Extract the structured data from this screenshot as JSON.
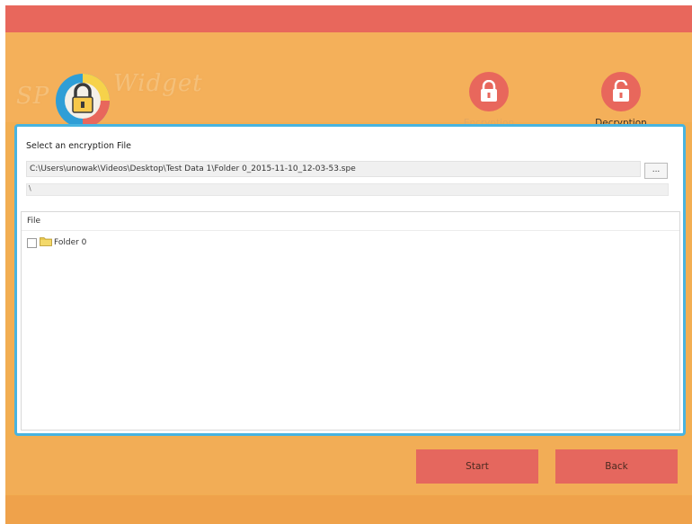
{
  "app": {
    "brand_prefix": "SP",
    "brand_name": "Widget"
  },
  "nav": {
    "encryption_label": "Encryption",
    "decryption_label": "Decryption",
    "active": "Decryption"
  },
  "panel": {
    "select_label": "Select an encryption File",
    "file_path": "C:\\Users\\unowak\\Videos\\Desktop\\Test Data 1\\Folder 0_2015-11-10_12-03-53.spe",
    "browse_label": "...",
    "progress_text": "\\",
    "tree": {
      "header": "File",
      "items": [
        {
          "label": "Folder 0",
          "checked": false
        }
      ]
    }
  },
  "footer": {
    "start_label": "Start",
    "back_label": "Back"
  },
  "colors": {
    "titlebar": "#e8675c",
    "background": "#f2ae52",
    "panel_border": "#48b4e0",
    "button": "#e5675e"
  },
  "icons": {
    "logo": "padlock-logo-icon",
    "encryption": "lock-closed-icon",
    "decryption": "lock-open-icon",
    "folder": "folder-icon"
  }
}
